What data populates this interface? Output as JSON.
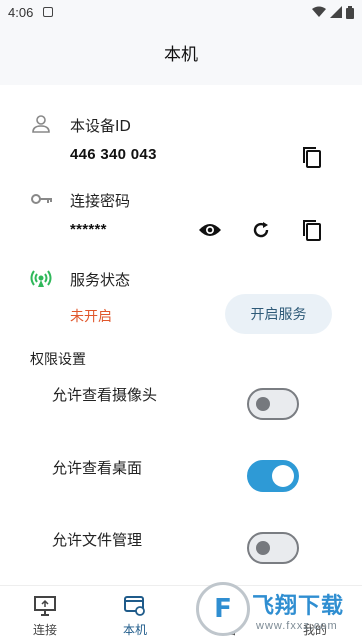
{
  "status_bar": {
    "time": "4:06"
  },
  "page": {
    "title": "本机"
  },
  "device_id": {
    "label": "本设备ID",
    "value": "446 340 043"
  },
  "password": {
    "label": "连接密码",
    "value": "******"
  },
  "service": {
    "label": "服务状态",
    "state_text": "未开启",
    "start_button": "开启服务",
    "accent_color": "#e0572c",
    "indicator_color": "#2fb85a"
  },
  "permissions": {
    "heading": "权限设置",
    "items": [
      {
        "label": "允许查看摄像头",
        "enabled": false
      },
      {
        "label": "允许查看桌面",
        "enabled": true
      },
      {
        "label": "允许文件管理",
        "enabled": false
      }
    ]
  },
  "bottom_nav": {
    "items": [
      {
        "label": "连接",
        "icon": "monitor-icon",
        "active": false
      },
      {
        "label": "本机",
        "icon": "local-device-icon",
        "active": true
      },
      {
        "label": "设备",
        "icon": "devices-icon",
        "active": false
      },
      {
        "label": "我的",
        "icon": "profile-icon",
        "active": false
      }
    ]
  },
  "watermark": {
    "logo_letter": "F",
    "text": "飞翔下载",
    "url": "www.fxxz.com"
  },
  "colors": {
    "toggle_on": "#2e9ad6",
    "active_nav": "#1f5b8a"
  }
}
